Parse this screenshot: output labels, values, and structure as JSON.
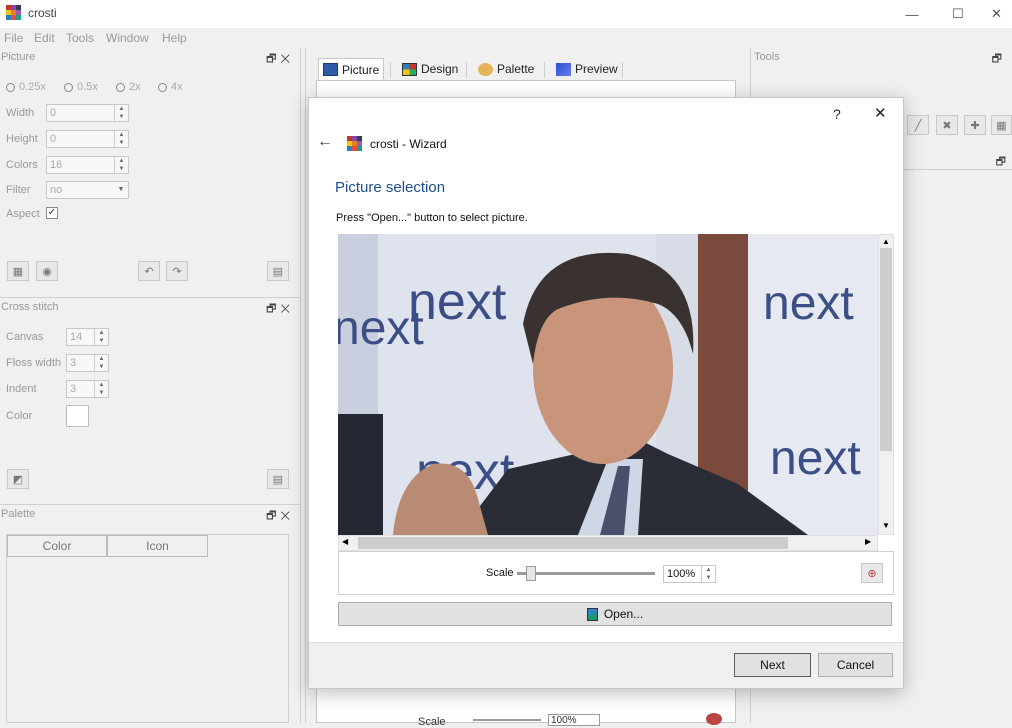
{
  "window": {
    "title": "crosti",
    "min": "—",
    "max": "☐",
    "close": "✕"
  },
  "menu": [
    "File",
    "Edit",
    "Tools",
    "Window",
    "Help"
  ],
  "picture_panel": {
    "title": "Picture",
    "scales": [
      "0.25x",
      "0.5x",
      "2x",
      "4x"
    ],
    "width_label": "Width",
    "width_value": "0",
    "height_label": "Height",
    "height_value": "0",
    "colors_label": "Colors",
    "colors_value": "16",
    "filter_label": "Filter",
    "filter_value": "no",
    "aspect_label": "Aspect",
    "aspect_check": "✓"
  },
  "cross_stitch_panel": {
    "title": "Cross stitch",
    "canvas_label": "Canvas",
    "canvas_value": "14",
    "floss_label": "Floss width",
    "floss_value": "3",
    "indent_label": "Indent",
    "indent_value": "3",
    "color_label": "Color"
  },
  "palette_panel": {
    "title": "Palette",
    "col_color": "Color",
    "col_icon": "Icon"
  },
  "tools_panel": {
    "title": "Tools"
  },
  "panel_buttons": "🗗✕",
  "tabs": [
    "Picture",
    "Design",
    "Palette",
    "Preview"
  ],
  "bottom_strip": {
    "scale_label": "Scale",
    "scale_value": "100%"
  },
  "wizard": {
    "help": "?",
    "close": "✕",
    "back": "←",
    "title": "crosti - Wizard",
    "heading": "Picture selection",
    "instruction": "Press \"Open...\" button to select picture.",
    "scale_label": "Scale",
    "scale_value": "100%",
    "scale_fraction": 0.07,
    "open_label": "Open...",
    "next_label": "Next",
    "cancel_label": "Cancel",
    "photo_texts": [
      "next",
      "next",
      "next",
      "next",
      "next"
    ]
  }
}
